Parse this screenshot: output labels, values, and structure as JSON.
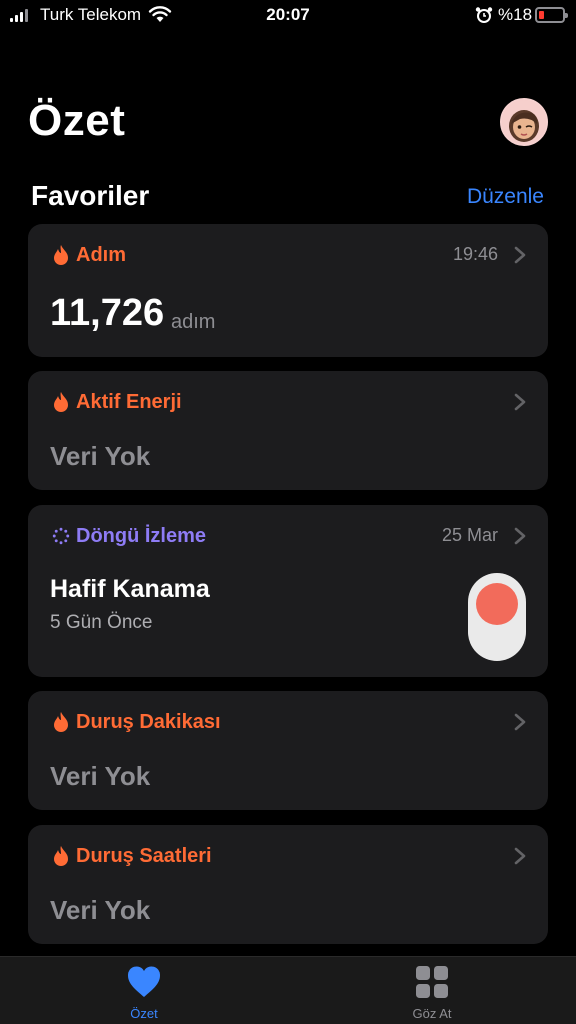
{
  "status_bar": {
    "carrier": "Turk Telekom",
    "time": "20:07",
    "battery_percent": "%18",
    "battery_level": 0.18
  },
  "header": {
    "title": "Özet"
  },
  "favorites": {
    "title": "Favoriler",
    "edit_label": "Düzenle"
  },
  "cards": {
    "steps": {
      "label": "Adım",
      "time": "19:46",
      "value": "11,726",
      "unit": "adım",
      "color": "#ff6b35"
    },
    "active_energy": {
      "label": "Aktif Enerji",
      "value": "Veri Yok",
      "color": "#ff6b35"
    },
    "cycle": {
      "label": "Döngü İzleme",
      "date": "25 Mar",
      "value": "Hafif Kanama",
      "sub": "5 Gün Önce",
      "color": "#8e7cf5"
    },
    "stand_minutes": {
      "label": "Duruş Dakikası",
      "value": "Veri Yok",
      "color": "#ff6b35"
    },
    "stand_hours": {
      "label": "Duruş Saatleri",
      "value": "Veri Yok",
      "color": "#ff6b35"
    }
  },
  "tab_bar": {
    "summary": {
      "label": "Özet",
      "icon": "heart-icon",
      "color": "#3a86ff"
    },
    "browse": {
      "label": "Göz At",
      "icon": "grid-icon",
      "color": "#8e8e93"
    }
  }
}
